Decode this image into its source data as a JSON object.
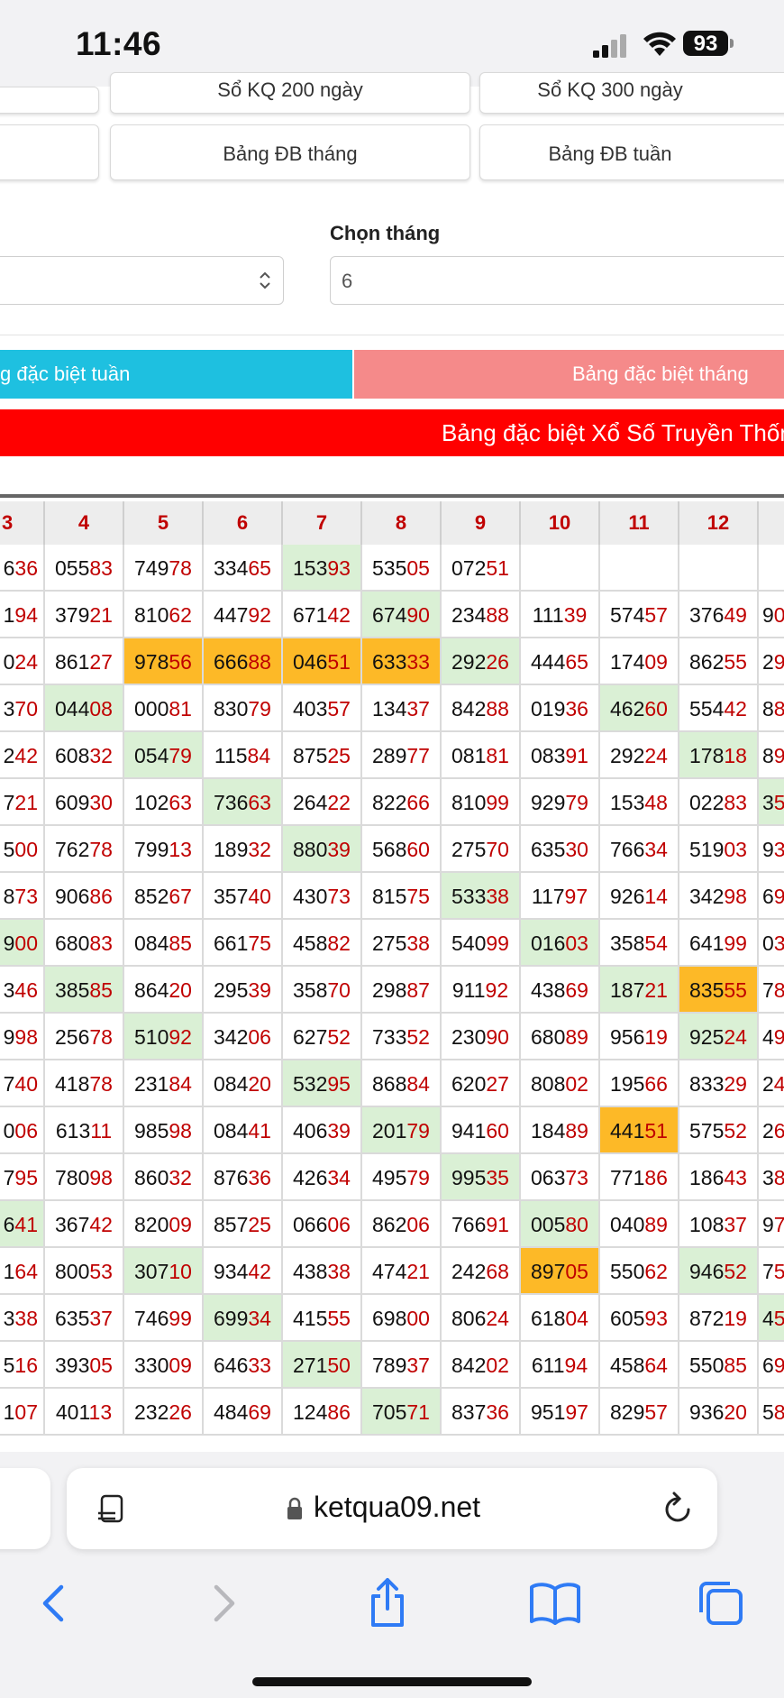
{
  "status": {
    "time": "11:46",
    "battery": "93"
  },
  "buttons": {
    "row1_mid": "Sổ KQ 200 ngày",
    "row1_right": "Sổ KQ 300 ngày",
    "row2_mid": "Bảng ĐB tháng",
    "row2_right": "Bảng ĐB tuần"
  },
  "month_picker": {
    "label": "Chọn tháng",
    "value": "6"
  },
  "tabs": {
    "week": "g đặc biệt tuần",
    "month": "Bảng đặc biệt tháng"
  },
  "banner": "Bảng đặc biệt Xổ Số Truyền Thống",
  "table": {
    "headers": [
      "3",
      "4",
      "5",
      "6",
      "7",
      "8",
      "9",
      "10",
      "11",
      "12",
      ""
    ],
    "rows": [
      [
        {
          "h": "6",
          "t": "36"
        },
        {
          "h": "055",
          "t": "83"
        },
        {
          "h": "749",
          "t": "78"
        },
        {
          "h": "334",
          "t": "65"
        },
        {
          "h": "153",
          "t": "93",
          "c": "g"
        },
        {
          "h": "535",
          "t": "05"
        },
        {
          "h": "072",
          "t": "51"
        },
        {
          "h": "",
          "t": ""
        },
        {
          "h": "",
          "t": ""
        },
        {
          "h": "",
          "t": ""
        },
        {
          "h": "",
          "t": ""
        }
      ],
      [
        {
          "h": "1",
          "t": "94"
        },
        {
          "h": "379",
          "t": "21"
        },
        {
          "h": "810",
          "t": "62"
        },
        {
          "h": "447",
          "t": "92"
        },
        {
          "h": "671",
          "t": "42"
        },
        {
          "h": "674",
          "t": "90",
          "c": "g"
        },
        {
          "h": "234",
          "t": "88"
        },
        {
          "h": "111",
          "t": "39"
        },
        {
          "h": "574",
          "t": "57"
        },
        {
          "h": "376",
          "t": "49"
        },
        {
          "h": "9",
          "t": "0"
        }
      ],
      [
        {
          "h": "0",
          "t": "24"
        },
        {
          "h": "861",
          "t": "27"
        },
        {
          "h": "978",
          "t": "56",
          "c": "o"
        },
        {
          "h": "666",
          "t": "88",
          "c": "o"
        },
        {
          "h": "046",
          "t": "51",
          "c": "o"
        },
        {
          "h": "633",
          "t": "33",
          "c": "o"
        },
        {
          "h": "292",
          "t": "26",
          "c": "g"
        },
        {
          "h": "444",
          "t": "65"
        },
        {
          "h": "174",
          "t": "09"
        },
        {
          "h": "862",
          "t": "55"
        },
        {
          "h": "2",
          "t": "9"
        }
      ],
      [
        {
          "h": "3",
          "t": "70"
        },
        {
          "h": "044",
          "t": "08",
          "c": "g"
        },
        {
          "h": "000",
          "t": "81"
        },
        {
          "h": "830",
          "t": "79"
        },
        {
          "h": "403",
          "t": "57"
        },
        {
          "h": "134",
          "t": "37"
        },
        {
          "h": "842",
          "t": "88"
        },
        {
          "h": "019",
          "t": "36"
        },
        {
          "h": "462",
          "t": "60",
          "c": "g"
        },
        {
          "h": "554",
          "t": "42"
        },
        {
          "h": "8",
          "t": "8"
        }
      ],
      [
        {
          "h": "2",
          "t": "42"
        },
        {
          "h": "608",
          "t": "32"
        },
        {
          "h": "054",
          "t": "79",
          "c": "g"
        },
        {
          "h": "115",
          "t": "84"
        },
        {
          "h": "875",
          "t": "25"
        },
        {
          "h": "289",
          "t": "77"
        },
        {
          "h": "081",
          "t": "81"
        },
        {
          "h": "083",
          "t": "91"
        },
        {
          "h": "292",
          "t": "24"
        },
        {
          "h": "178",
          "t": "18",
          "c": "g"
        },
        {
          "h": "8",
          "t": "9"
        }
      ],
      [
        {
          "h": "7",
          "t": "21"
        },
        {
          "h": "609",
          "t": "30"
        },
        {
          "h": "102",
          "t": "63"
        },
        {
          "h": "736",
          "t": "63",
          "c": "g"
        },
        {
          "h": "264",
          "t": "22"
        },
        {
          "h": "822",
          "t": "66"
        },
        {
          "h": "810",
          "t": "99"
        },
        {
          "h": "929",
          "t": "79"
        },
        {
          "h": "153",
          "t": "48"
        },
        {
          "h": "022",
          "t": "83"
        },
        {
          "h": "3",
          "t": "5",
          "c": "g"
        }
      ],
      [
        {
          "h": "5",
          "t": "00"
        },
        {
          "h": "762",
          "t": "78"
        },
        {
          "h": "799",
          "t": "13"
        },
        {
          "h": "189",
          "t": "32"
        },
        {
          "h": "880",
          "t": "39",
          "c": "g"
        },
        {
          "h": "568",
          "t": "60"
        },
        {
          "h": "275",
          "t": "70"
        },
        {
          "h": "635",
          "t": "30"
        },
        {
          "h": "766",
          "t": "34"
        },
        {
          "h": "519",
          "t": "03"
        },
        {
          "h": "9",
          "t": "3"
        }
      ],
      [
        {
          "h": "8",
          "t": "73"
        },
        {
          "h": "906",
          "t": "86"
        },
        {
          "h": "852",
          "t": "67"
        },
        {
          "h": "357",
          "t": "40"
        },
        {
          "h": "430",
          "t": "73"
        },
        {
          "h": "815",
          "t": "75"
        },
        {
          "h": "533",
          "t": "38",
          "c": "g"
        },
        {
          "h": "117",
          "t": "97"
        },
        {
          "h": "926",
          "t": "14"
        },
        {
          "h": "342",
          "t": "98"
        },
        {
          "h": "6",
          "t": "9"
        }
      ],
      [
        {
          "h": "9",
          "t": "00",
          "c": "g"
        },
        {
          "h": "680",
          "t": "83"
        },
        {
          "h": "084",
          "t": "85"
        },
        {
          "h": "661",
          "t": "75"
        },
        {
          "h": "458",
          "t": "82"
        },
        {
          "h": "275",
          "t": "38"
        },
        {
          "h": "540",
          "t": "99"
        },
        {
          "h": "016",
          "t": "03",
          "c": "g"
        },
        {
          "h": "358",
          "t": "54"
        },
        {
          "h": "641",
          "t": "99"
        },
        {
          "h": "0",
          "t": "3"
        }
      ],
      [
        {
          "h": "3",
          "t": "46"
        },
        {
          "h": "385",
          "t": "85",
          "c": "g"
        },
        {
          "h": "864",
          "t": "20"
        },
        {
          "h": "295",
          "t": "39"
        },
        {
          "h": "358",
          "t": "70"
        },
        {
          "h": "298",
          "t": "87"
        },
        {
          "h": "911",
          "t": "92"
        },
        {
          "h": "438",
          "t": "69"
        },
        {
          "h": "187",
          "t": "21",
          "c": "g"
        },
        {
          "h": "835",
          "t": "55",
          "c": "o"
        },
        {
          "h": "7",
          "t": "8"
        }
      ],
      [
        {
          "h": "9",
          "t": "98"
        },
        {
          "h": "256",
          "t": "78"
        },
        {
          "h": "510",
          "t": "92",
          "c": "g"
        },
        {
          "h": "342",
          "t": "06"
        },
        {
          "h": "627",
          "t": "52"
        },
        {
          "h": "733",
          "t": "52"
        },
        {
          "h": "230",
          "t": "90"
        },
        {
          "h": "680",
          "t": "89"
        },
        {
          "h": "956",
          "t": "19"
        },
        {
          "h": "925",
          "t": "24",
          "c": "g"
        },
        {
          "h": "4",
          "t": "9"
        }
      ],
      [
        {
          "h": "7",
          "t": "40"
        },
        {
          "h": "418",
          "t": "78"
        },
        {
          "h": "231",
          "t": "84"
        },
        {
          "h": "084",
          "t": "20"
        },
        {
          "h": "532",
          "t": "95",
          "c": "g"
        },
        {
          "h": "868",
          "t": "84"
        },
        {
          "h": "620",
          "t": "27"
        },
        {
          "h": "808",
          "t": "02"
        },
        {
          "h": "195",
          "t": "66"
        },
        {
          "h": "833",
          "t": "29"
        },
        {
          "h": "2",
          "t": "4"
        }
      ],
      [
        {
          "h": "0",
          "t": "06"
        },
        {
          "h": "613",
          "t": "11"
        },
        {
          "h": "985",
          "t": "98"
        },
        {
          "h": "084",
          "t": "41"
        },
        {
          "h": "406",
          "t": "39"
        },
        {
          "h": "201",
          "t": "79",
          "c": "g"
        },
        {
          "h": "941",
          "t": "60"
        },
        {
          "h": "184",
          "t": "89"
        },
        {
          "h": "441",
          "t": "51",
          "c": "o"
        },
        {
          "h": "575",
          "t": "52"
        },
        {
          "h": "2",
          "t": "6"
        }
      ],
      [
        {
          "h": "7",
          "t": "95"
        },
        {
          "h": "780",
          "t": "98"
        },
        {
          "h": "860",
          "t": "32"
        },
        {
          "h": "876",
          "t": "36"
        },
        {
          "h": "426",
          "t": "34"
        },
        {
          "h": "495",
          "t": "79"
        },
        {
          "h": "995",
          "t": "35",
          "c": "g"
        },
        {
          "h": "063",
          "t": "73"
        },
        {
          "h": "771",
          "t": "86"
        },
        {
          "h": "186",
          "t": "43"
        },
        {
          "h": "3",
          "t": "8"
        }
      ],
      [
        {
          "h": "6",
          "t": "41",
          "c": "g"
        },
        {
          "h": "367",
          "t": "42"
        },
        {
          "h": "820",
          "t": "09"
        },
        {
          "h": "857",
          "t": "25"
        },
        {
          "h": "066",
          "t": "06"
        },
        {
          "h": "862",
          "t": "06"
        },
        {
          "h": "766",
          "t": "91"
        },
        {
          "h": "005",
          "t": "80",
          "c": "g"
        },
        {
          "h": "040",
          "t": "89"
        },
        {
          "h": "108",
          "t": "37"
        },
        {
          "h": "9",
          "t": "7"
        }
      ],
      [
        {
          "h": "1",
          "t": "64"
        },
        {
          "h": "800",
          "t": "53"
        },
        {
          "h": "307",
          "t": "10",
          "c": "g"
        },
        {
          "h": "934",
          "t": "42"
        },
        {
          "h": "438",
          "t": "38"
        },
        {
          "h": "474",
          "t": "21"
        },
        {
          "h": "242",
          "t": "68"
        },
        {
          "h": "897",
          "t": "05",
          "c": "o"
        },
        {
          "h": "550",
          "t": "62"
        },
        {
          "h": "946",
          "t": "52",
          "c": "g"
        },
        {
          "h": "7",
          "t": "5"
        }
      ],
      [
        {
          "h": "3",
          "t": "38"
        },
        {
          "h": "635",
          "t": "37"
        },
        {
          "h": "746",
          "t": "99"
        },
        {
          "h": "699",
          "t": "34",
          "c": "g"
        },
        {
          "h": "415",
          "t": "55"
        },
        {
          "h": "698",
          "t": "00"
        },
        {
          "h": "806",
          "t": "24"
        },
        {
          "h": "618",
          "t": "04"
        },
        {
          "h": "605",
          "t": "93"
        },
        {
          "h": "872",
          "t": "19"
        },
        {
          "h": "4",
          "t": "5",
          "c": "g"
        }
      ],
      [
        {
          "h": "5",
          "t": "16"
        },
        {
          "h": "393",
          "t": "05"
        },
        {
          "h": "330",
          "t": "09"
        },
        {
          "h": "646",
          "t": "33"
        },
        {
          "h": "271",
          "t": "50",
          "c": "g"
        },
        {
          "h": "789",
          "t": "37"
        },
        {
          "h": "842",
          "t": "02"
        },
        {
          "h": "611",
          "t": "94"
        },
        {
          "h": "458",
          "t": "64"
        },
        {
          "h": "550",
          "t": "85"
        },
        {
          "h": "6",
          "t": "9"
        }
      ],
      [
        {
          "h": "1",
          "t": "07"
        },
        {
          "h": "401",
          "t": "13"
        },
        {
          "h": "232",
          "t": "26"
        },
        {
          "h": "484",
          "t": "69"
        },
        {
          "h": "124",
          "t": "86"
        },
        {
          "h": "705",
          "t": "71",
          "c": "g"
        },
        {
          "h": "837",
          "t": "36"
        },
        {
          "h": "951",
          "t": "97"
        },
        {
          "h": "829",
          "t": "57"
        },
        {
          "h": "936",
          "t": "20"
        },
        {
          "h": "5",
          "t": "8"
        }
      ]
    ]
  },
  "browser": {
    "url": "ketqua09.net"
  },
  "icons": [
    "signal-icon",
    "wifi-icon",
    "battery-icon",
    "chevron-updown-icon",
    "page-menu-icon",
    "lock-icon",
    "reload-icon",
    "back-icon",
    "forward-icon",
    "share-icon",
    "bookmarks-icon",
    "tabs-icon"
  ],
  "colors": {
    "accent_week": "#1ec0e0",
    "accent_month": "#f58a8a",
    "banner": "#ff0000",
    "highlight_green": "#daf0d5",
    "highlight_orange": "#fdb927",
    "number_red": "#c00000"
  }
}
